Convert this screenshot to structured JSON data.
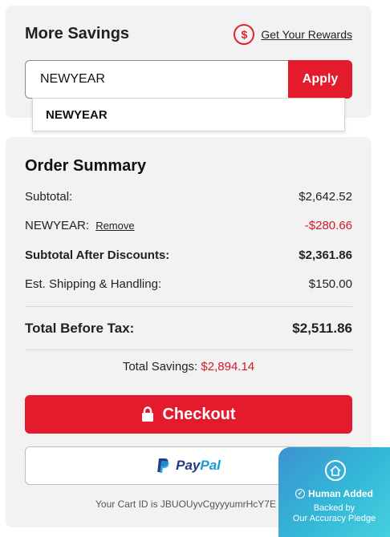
{
  "savings": {
    "title": "More Savings",
    "rewards_link": "Get Your Rewards",
    "dollar_glyph": "$",
    "promo_value": "NEWYEAR",
    "apply_label": "Apply",
    "suggestion": "NEWYEAR"
  },
  "summary": {
    "title": "Order Summary",
    "subtotal_label": "Subtotal:",
    "subtotal_value": "$2,642.52",
    "discount_label": "NEWYEAR:",
    "discount_remove": "Remove",
    "discount_value": "-$280.66",
    "after_discount_label": "Subtotal After Discounts:",
    "after_discount_value": "$2,361.86",
    "shipping_label": "Est. Shipping & Handling:",
    "shipping_value": "$150.00",
    "total_label": "Total Before Tax:",
    "total_value": "$2,511.86",
    "total_savings_label": "Total Savings:",
    "total_savings_value": "$2,894.14",
    "checkout_label": "Checkout",
    "paypal_pay": "Pay",
    "paypal_pal": "Pal",
    "cart_id": "Your Cart ID is JBUOUyvCgyyyumrHcY7E"
  },
  "badge": {
    "title": "Human Added",
    "sub_line1": "Backed by",
    "sub_line2": "Our Accuracy Pledge"
  },
  "colors": {
    "accent_red": "#e31b2d",
    "discount_red": "#d11a2a",
    "card_bg": "#f2f2f2",
    "paypal_dark": "#253b80",
    "paypal_light": "#179bd7",
    "badge_blue": "#34b8d8"
  }
}
